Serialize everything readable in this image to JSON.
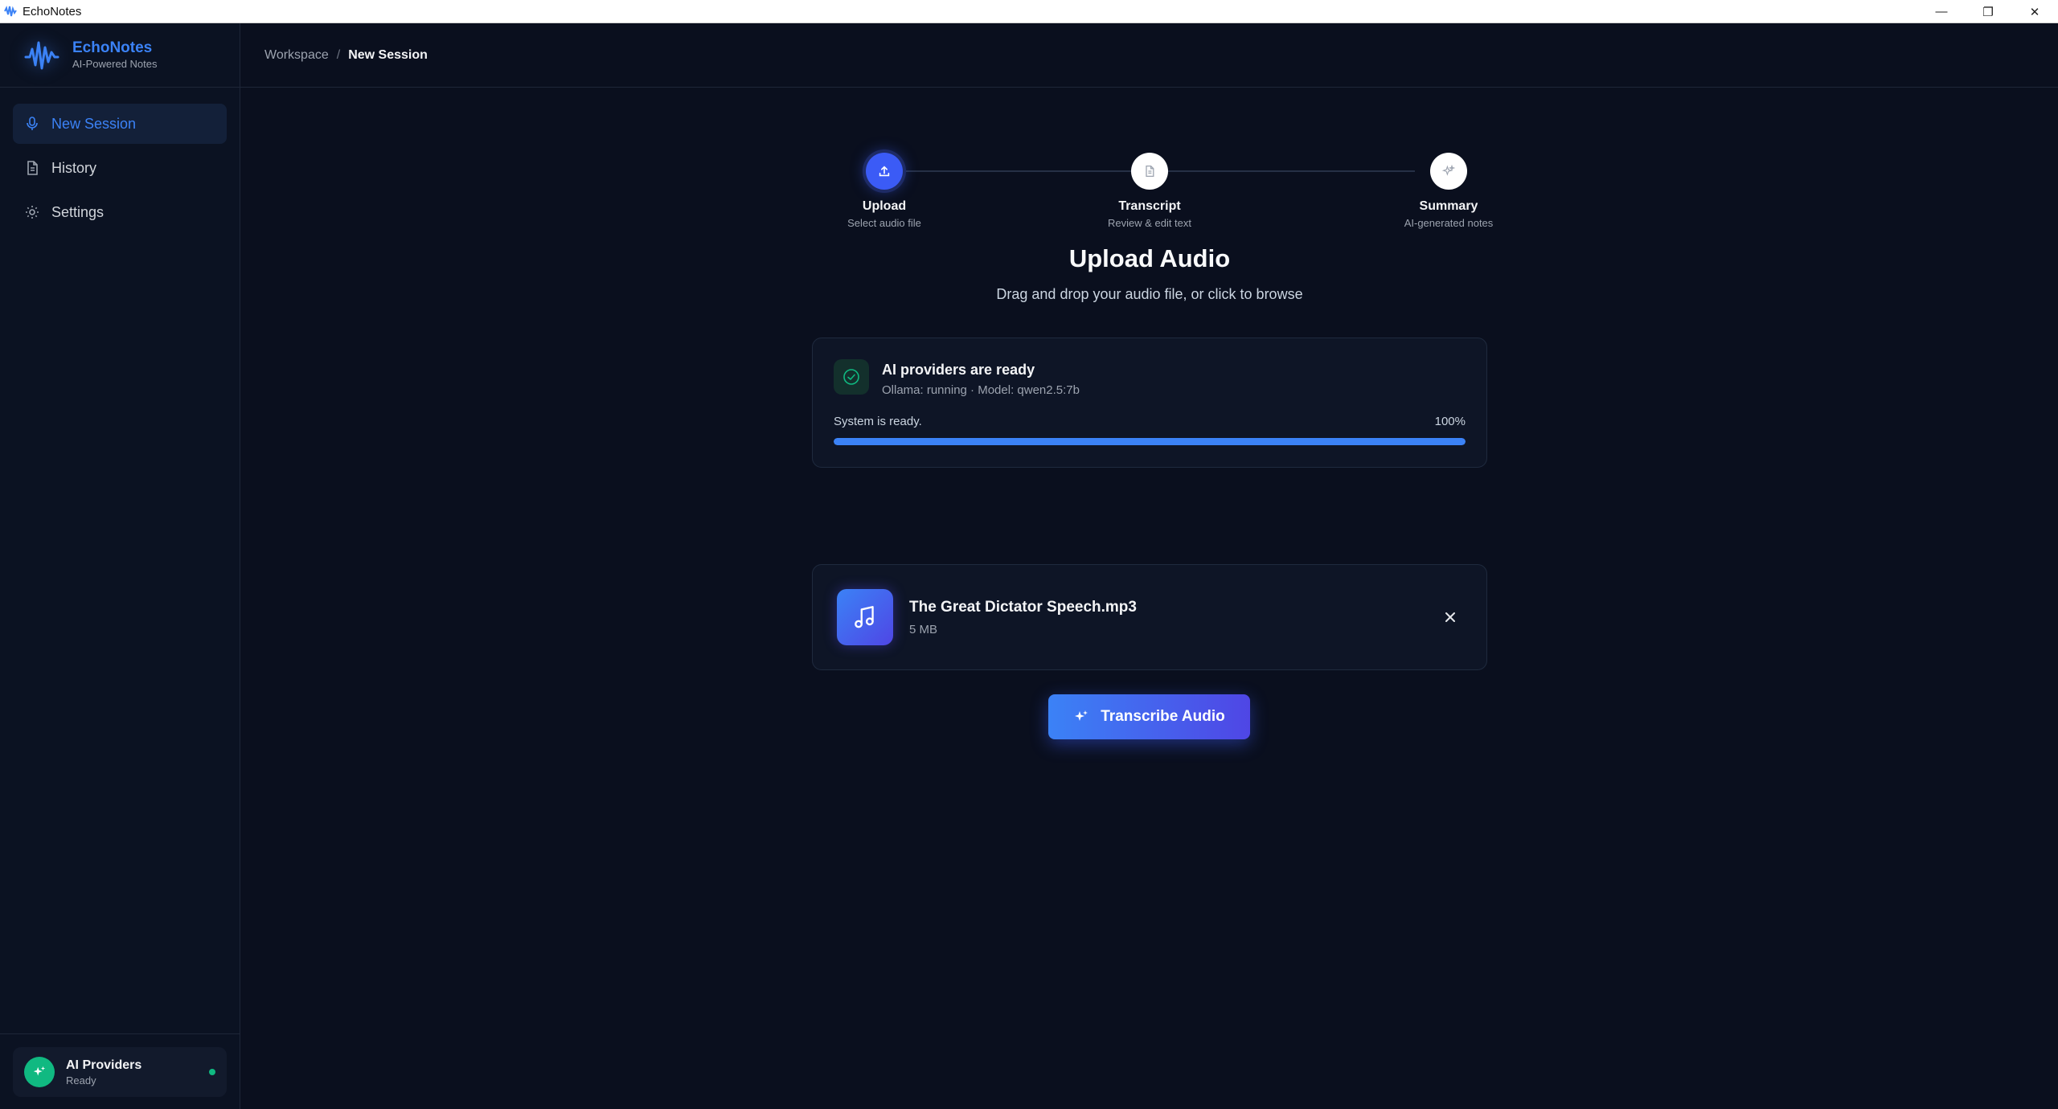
{
  "window": {
    "title": "EchoNotes",
    "controls": {
      "minimize": "—",
      "restore": "❐",
      "close": "✕"
    }
  },
  "brand": {
    "name": "EchoNotes",
    "tagline": "AI-Powered Notes",
    "logo_icon": "waveform-icon",
    "accent_color": "#3b82f6"
  },
  "sidebar": {
    "items": [
      {
        "label": "New Session",
        "icon": "microphone-icon",
        "active": true
      },
      {
        "label": "History",
        "icon": "document-icon",
        "active": false
      },
      {
        "label": "Settings",
        "icon": "gear-icon",
        "active": false
      }
    ],
    "footer": {
      "name": "AI Providers",
      "status": "Ready",
      "icon": "sparkles-icon",
      "status_color": "#10b981"
    }
  },
  "breadcrumb": {
    "root": "Workspace",
    "separator": "/",
    "current": "New Session"
  },
  "stepper": {
    "steps": [
      {
        "label": "Upload",
        "sub": "Select audio file",
        "icon": "upload-icon",
        "active": true
      },
      {
        "label": "Transcript",
        "sub": "Review & edit text",
        "icon": "document-icon",
        "active": false
      },
      {
        "label": "Summary",
        "sub": "AI-generated notes",
        "icon": "sparkles-icon",
        "active": false
      }
    ]
  },
  "main": {
    "title": "Upload Audio",
    "subtitle": "Drag and drop your audio file, or click to browse"
  },
  "ready_card": {
    "title": "AI providers are ready",
    "detail": "Ollama: running · Model: qwen2.5:7b",
    "status_text": "System is ready.",
    "percent_label": "100%",
    "progress": 1.0
  },
  "file": {
    "name": "The Great Dictator Speech.mp3",
    "size": "5 MB",
    "icon": "music-note-icon"
  },
  "actions": {
    "transcribe_label": "Transcribe Audio"
  }
}
